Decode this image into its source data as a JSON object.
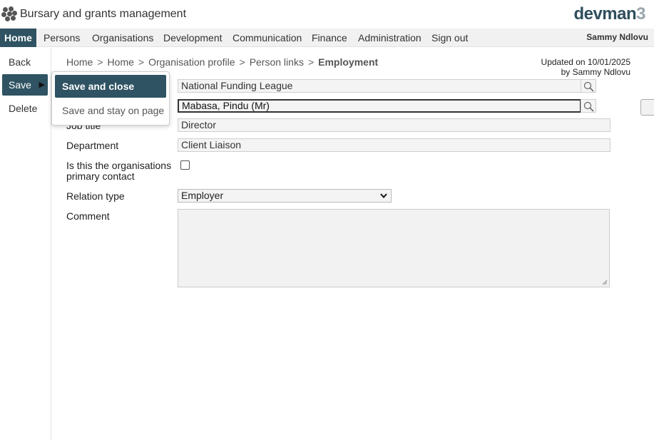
{
  "header": {
    "app_title": "Bursary and grants management",
    "brand_text": "devman",
    "brand_number": "3",
    "logo_icon": "dots-logo-icon"
  },
  "topnav": {
    "items": [
      {
        "label": "Home",
        "active": true
      },
      {
        "label": "Persons"
      },
      {
        "label": "Organisations"
      },
      {
        "label": "Development"
      },
      {
        "label": "Communication"
      },
      {
        "label": "Finance"
      },
      {
        "label": "Administration"
      },
      {
        "label": "Sign out"
      }
    ],
    "user_name": "Sammy Ndlovu"
  },
  "sidebar": {
    "back_label": "Back",
    "save_label": "Save",
    "save_arrow": "▶",
    "delete_label": "Delete"
  },
  "save_menu": {
    "save_close_label": "Save and close",
    "save_stay_label": "Save and stay on page"
  },
  "breadcrumb": {
    "items": [
      "Home",
      "Home",
      "Organisation profile",
      "Person links"
    ],
    "separator": ">",
    "current": "Employment"
  },
  "updated": {
    "line1": "Updated on 10/01/2025",
    "line2": "by Sammy Ndlovu"
  },
  "form": {
    "organisation_value": "National Funding League",
    "person_value": "Mabasa, Pindu (Mr)",
    "job_title_label": "Job title",
    "job_title_value": "Director",
    "department_label": "Department",
    "department_value": "Client Liaison",
    "primary_contact_label_1": "Is this the organisations",
    "primary_contact_label_2": "primary contact",
    "primary_contact_checked": false,
    "relation_type_label": "Relation type",
    "relation_type_value": "Employer",
    "comment_label": "Comment",
    "comment_value": ""
  },
  "colors": {
    "accent": "#2f5362",
    "brand": "#2f4e5c",
    "field_background": "#f4f4f4"
  }
}
